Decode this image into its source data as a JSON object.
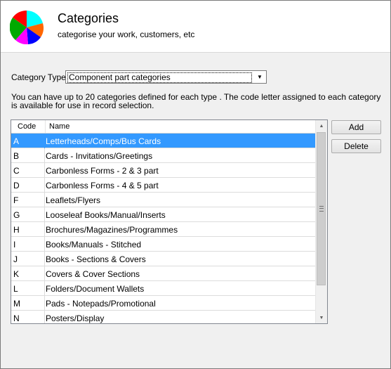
{
  "header": {
    "title": "Categories",
    "subtitle": "categorise your work, customers, etc",
    "logo_icon": "pie-chart-icon",
    "logo_colors": [
      "#00ffff",
      "#ff0000",
      "#ff6600",
      "#ff00ff",
      "#0000ff",
      "#00aa00"
    ]
  },
  "category_type": {
    "label": "Category Type",
    "selected": "Component part categories"
  },
  "info_text": "You can have up to 20 categories defined for each type . The code letter assigned to each category is available for use in record selection.",
  "table": {
    "columns": [
      "Code",
      "Name"
    ],
    "selected_index": 0,
    "rows": [
      {
        "code": "A",
        "name": "Letterheads/Comps/Bus Cards"
      },
      {
        "code": "B",
        "name": "Cards - Invitations/Greetings"
      },
      {
        "code": "C",
        "name": "Carbonless Forms - 2 & 3 part"
      },
      {
        "code": "D",
        "name": "Carbonless Forms - 4 & 5 part"
      },
      {
        "code": "F",
        "name": "Leaflets/Flyers"
      },
      {
        "code": "G",
        "name": "Looseleaf Books/Manual/Inserts"
      },
      {
        "code": "H",
        "name": "Brochures/Magazines/Programmes"
      },
      {
        "code": "I",
        "name": "Books/Manuals - Stitched"
      },
      {
        "code": "J",
        "name": "Books - Sections & Covers"
      },
      {
        "code": "K",
        "name": "Covers & Cover Sections"
      },
      {
        "code": "L",
        "name": "Folders/Document Wallets"
      },
      {
        "code": "M",
        "name": "Pads - Notepads/Promotional"
      },
      {
        "code": "N",
        "name": "Posters/Display"
      }
    ]
  },
  "buttons": {
    "add": "Add",
    "delete": "Delete"
  },
  "colors": {
    "selection": "#3399ff",
    "window_bg": "#f0f0f0"
  }
}
